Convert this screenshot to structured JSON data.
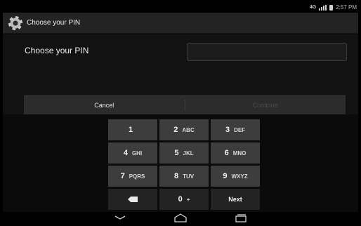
{
  "status_bar": {
    "network": "4G",
    "time": "2:57 PM",
    "icons": [
      "signal-icon",
      "battery-icon"
    ]
  },
  "action_bar": {
    "title": "Choose your PIN",
    "icon": "settings-gear-icon"
  },
  "form": {
    "label": "Choose your PIN",
    "pin_value": ""
  },
  "buttons": {
    "cancel": "Cancel",
    "continue": "Continue"
  },
  "keypad": {
    "keys": [
      {
        "main": "1",
        "sub": ""
      },
      {
        "main": "2",
        "sub": "ABC"
      },
      {
        "main": "3",
        "sub": "DEF"
      },
      {
        "main": "4",
        "sub": "GHI"
      },
      {
        "main": "5",
        "sub": "JKL"
      },
      {
        "main": "6",
        "sub": "MNO"
      },
      {
        "main": "7",
        "sub": "PQRS"
      },
      {
        "main": "8",
        "sub": "TUV"
      },
      {
        "main": "9",
        "sub": "WXYZ"
      },
      {
        "main": "",
        "sub": ""
      },
      {
        "main": "0",
        "sub": "+"
      },
      {
        "main": "Next",
        "sub": ""
      }
    ]
  },
  "nav_bar": {
    "buttons": [
      "back-icon",
      "home-icon",
      "recent-apps-icon"
    ]
  }
}
